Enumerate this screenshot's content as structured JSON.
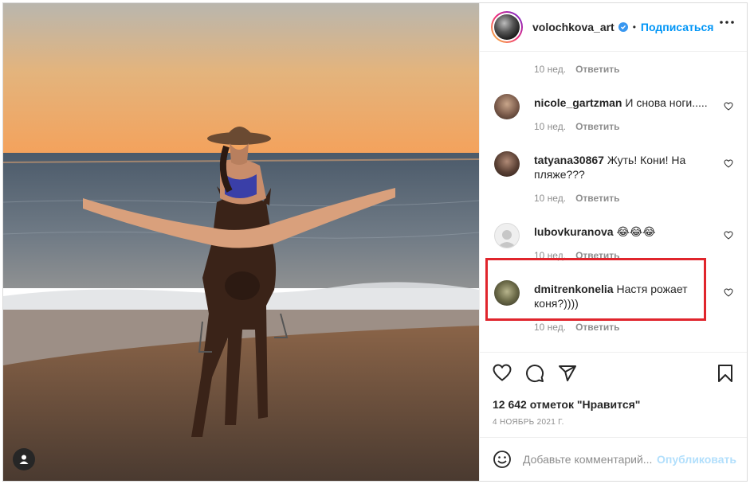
{
  "post": {
    "author": "volochkova_art",
    "follow_label": "Подписаться",
    "separator": "•",
    "likes_text": "12 642 отметок \"Нравится\"",
    "date_text": "4 ноябрь 2021 г."
  },
  "comments": [
    {
      "user": "",
      "text": "",
      "time": "10 нед.",
      "reply": "Ответить"
    },
    {
      "user": "nicole_gartzman",
      "text": "И снова ноги.....",
      "time": "10 нед.",
      "reply": "Ответить"
    },
    {
      "user": "tatyana30867",
      "text": "Жуть! Кони! На пляже???",
      "time": "10 нед.",
      "reply": "Ответить"
    },
    {
      "user": "lubovkuranova",
      "text": "😂😂😂",
      "time": "10 нед.",
      "reply": "Ответить"
    },
    {
      "user": "dmitrenkonelia",
      "text": "Настя рожает коня?))))",
      "time": "10 нед.",
      "reply": "Ответить"
    }
  ],
  "add_comment": {
    "placeholder": "Добавьте комментарий...",
    "publish_label": "Опубликовать"
  },
  "colors": {
    "accent": "#0095f6",
    "highlight_box": "#e0252c",
    "publish_disabled": "#b2dffc"
  },
  "icons": [
    "user-tag-icon",
    "verified-icon",
    "more-options-icon",
    "heart-icon",
    "comment-icon",
    "share-icon",
    "bookmark-icon",
    "emoji-icon"
  ]
}
